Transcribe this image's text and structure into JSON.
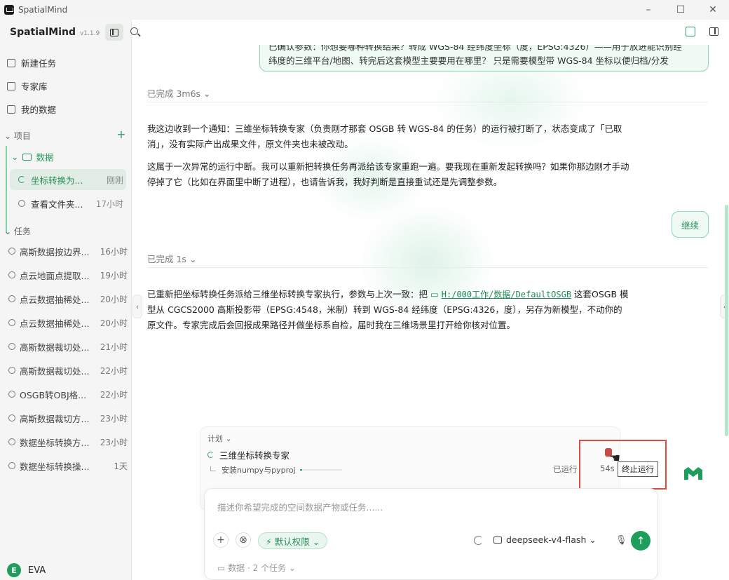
{
  "window": {
    "title": "SpatialMind",
    "controls": [
      "–",
      "☐",
      "✕"
    ]
  },
  "brand": {
    "name": "SpatialMind",
    "version": "v1.1.9"
  },
  "nav": {
    "new_task": "新建任务",
    "experts": "专家库",
    "my_data": "我的数据"
  },
  "projects": {
    "header": "项目",
    "add": "+",
    "folder": "数据",
    "tasks": [
      {
        "label": "坐标转换为...",
        "time": "刚刚",
        "active": true
      },
      {
        "label": "查看文件夹...",
        "time": "17小时",
        "active": false
      }
    ]
  },
  "history": {
    "header": "任务",
    "items": [
      {
        "label": "高斯数据按边界...",
        "time": "16小时"
      },
      {
        "label": "点云地面点提取...",
        "time": "19小时"
      },
      {
        "label": "点云数据抽稀处...",
        "time": "20小时"
      },
      {
        "label": "点云数据抽稀处...",
        "time": "20小时"
      },
      {
        "label": "高斯数据裁切处...",
        "time": "21小时"
      },
      {
        "label": "高斯数据裁切处...",
        "time": "22小时"
      },
      {
        "label": "OSGB转OBJ格...",
        "time": "22小时"
      },
      {
        "label": "高斯数据裁切方...",
        "time": "23小时"
      },
      {
        "label": "数据坐标转换方...",
        "time": "23小时"
      },
      {
        "label": "数据坐标转换操...",
        "time": "1天"
      }
    ]
  },
  "user": {
    "initial": "E",
    "name": "EVA"
  },
  "chat": {
    "user_bubble_line1": "已确认参数：你想要哪种转换结果？转成 WGS-84 经纬度坐标（度，EPSG:4326）——用于放进能识别经",
    "user_bubble_line2": "纬度的三维平台/地图、转完后这套模型主要要用在哪里？ 只是需要模型带 WGS-84 坐标以便归档/分发",
    "status1": "已完成 3m6s ⌄",
    "msg1_p1": "我这边收到一个通知：三维坐标转换专家（负责刚才那套 OSGB 转 WGS-84 的任务）的运行被打断了，状态变成了「已取消」，没有实际产出成果文件，原文件夹也未被改动。",
    "msg1_p2": "这属于一次异常的运行中断。我可以重新把转换任务再派给该专家重跑一遍。要我现在重新发起转换吗？如果你那边刚才手动停掉了它（比如在界面里中断了进程），也请告诉我，我好判断是直接重试还是先调整参数。",
    "continue_label": "继续",
    "status2": "已完成 1s ⌄",
    "msg2_before": "已重新把坐标转换任务派给三维坐标转换专家执行，参数与上次一致：把 ",
    "msg2_path": "H:/000工作/数据/DefaultOSGB",
    "msg2_after": " 这套OSGB 模型从 CGCS2000 高斯投影带（EPSG:4548，米制）转到 WGS-84 经纬度（EPSG:4326，度），另存为新模型，不动你的原文件。专家完成后会回报成果路径并做坐标系自检，届时我在三维场景里打开给你核对位置。"
  },
  "plan": {
    "header": "计划 ⌄",
    "agent": "三维坐标转换专家",
    "subtask": "安装numpy与pyproj",
    "progress": 0.05,
    "status": "已运行",
    "elapsed": "54s",
    "stop_tooltip": "终止运行"
  },
  "input": {
    "placeholder": "描述你希望完成的空间数据产物或任务......",
    "permission": "⚡ 默认权限 ⌄",
    "model": "deepseek-v4-flash ⌄",
    "send": "↑",
    "footer": "▭ 数据 · 2 个任务 ⌄"
  },
  "colors": {
    "accent": "#1f9d5c",
    "highlight_border": "#e04a3f",
    "bubble_bg": "#eefaf3"
  }
}
